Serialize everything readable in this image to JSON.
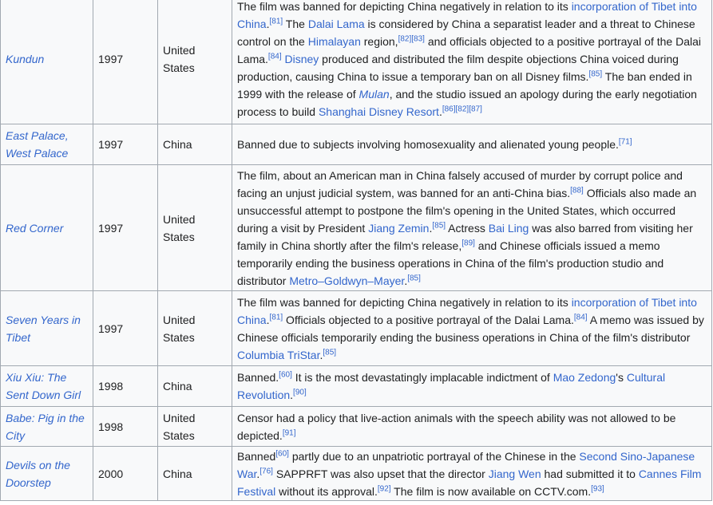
{
  "rows": [
    {
      "title": "Kundun",
      "year": "1997",
      "country": "United States",
      "notes": [
        {
          "t": "The film was banned for depicting China negatively in relation to its "
        },
        {
          "t": "incorporation of Tibet into China",
          "link": true
        },
        {
          "t": ".",
          "ref": "[81]"
        },
        {
          "t": " The "
        },
        {
          "t": "Dalai Lama",
          "link": true
        },
        {
          "t": " is considered by China a separatist leader and a threat to Chinese control on the "
        },
        {
          "t": "Himalayan",
          "link": true
        },
        {
          "t": " region,",
          "ref": "[82][83]"
        },
        {
          "t": " and officials objected to a positive portrayal of the Dalai Lama.",
          "ref": "[84]"
        },
        {
          "t": " "
        },
        {
          "t": "Disney",
          "link": true
        },
        {
          "t": " produced and distributed the film despite objections China voiced during production, causing China to issue a temporary ban on all Disney films.",
          "ref": "[85]"
        },
        {
          "t": " The ban ended in 1999 with the release of "
        },
        {
          "t": "Mulan",
          "link": true,
          "italic": true
        },
        {
          "t": ", and the studio issued an apology during the early negotiation process to build "
        },
        {
          "t": "Shanghai Disney Resort",
          "link": true
        },
        {
          "t": ".",
          "ref": "[86][82][87]"
        }
      ]
    },
    {
      "title": "East Palace, West Palace",
      "year": "1997",
      "country": "China",
      "notes": [
        {
          "t": "Banned due to subjects involving homosexuality and alienated young people.",
          "ref": "[71]"
        }
      ]
    },
    {
      "title": "Red Corner",
      "year": "1997",
      "country": "United States",
      "notes": [
        {
          "t": "The film, about an American man in China falsely accused of murder by corrupt police and facing an unjust judicial system, was banned for an anti-China bias.",
          "ref": "[88]"
        },
        {
          "t": " Officials also made an unsuccessful attempt to postpone the film's opening in the United States, which occurred during a visit by President "
        },
        {
          "t": "Jiang Zemin",
          "link": true
        },
        {
          "t": ".",
          "ref": "[85]"
        },
        {
          "t": " Actress "
        },
        {
          "t": "Bai Ling",
          "link": true
        },
        {
          "t": " was also barred from visiting her family in China shortly after the film's release,",
          "ref": "[89]"
        },
        {
          "t": " and Chinese officials issued a memo temporarily ending the business operations in China of the film's production studio and distributor "
        },
        {
          "t": "Metro–Goldwyn–Mayer",
          "link": true
        },
        {
          "t": ".",
          "ref": "[85]"
        }
      ]
    },
    {
      "title": "Seven Years in Tibet",
      "year": "1997",
      "country": "United States",
      "notes": [
        {
          "t": "The film was banned for depicting China negatively in relation to its "
        },
        {
          "t": "incorporation of Tibet into China",
          "link": true
        },
        {
          "t": ".",
          "ref": "[81]"
        },
        {
          "t": " Officials objected to a positive portrayal of the Dalai Lama.",
          "ref": "[84]"
        },
        {
          "t": " A memo was issued by Chinese officials temporarily ending the business operations in China of the film's distributor "
        },
        {
          "t": "Columbia TriStar",
          "link": true
        },
        {
          "t": ".",
          "ref": "[85]"
        }
      ]
    },
    {
      "title": "Xiu Xiu: The Sent Down Girl",
      "year": "1998",
      "country": "China",
      "notes": [
        {
          "t": "Banned.",
          "ref": "[60]"
        },
        {
          "t": " It is the most devastatingly implacable indictment of "
        },
        {
          "t": "Mao Zedong",
          "link": true
        },
        {
          "t": "'s "
        },
        {
          "t": "Cultural Revolution",
          "link": true
        },
        {
          "t": ".",
          "ref": "[90]"
        }
      ]
    },
    {
      "title": "Babe: Pig in the City",
      "year": "1998",
      "country": "United States",
      "notes": [
        {
          "t": "Censor had a policy that live-action animals with the speech ability was not allowed to be depicted.",
          "ref": "[91]"
        }
      ]
    },
    {
      "title": "Devils on the Doorstep",
      "year": "2000",
      "country": "China",
      "notes": [
        {
          "t": "Banned",
          "ref": "[60]"
        },
        {
          "t": " partly due to an unpatriotic portrayal of the Chinese in the "
        },
        {
          "t": "Second Sino-Japanese War",
          "link": true
        },
        {
          "t": ".",
          "ref": "[76]"
        },
        {
          "t": " SAPPRFT was also upset that the director "
        },
        {
          "t": "Jiang Wen",
          "link": true
        },
        {
          "t": " had submitted it to "
        },
        {
          "t": "Cannes Film Festival",
          "link": true
        },
        {
          "t": " without its approval.",
          "ref": "[92]"
        },
        {
          "t": " The film is now available on CCTV.com.",
          "ref": "[93]"
        }
      ]
    }
  ]
}
